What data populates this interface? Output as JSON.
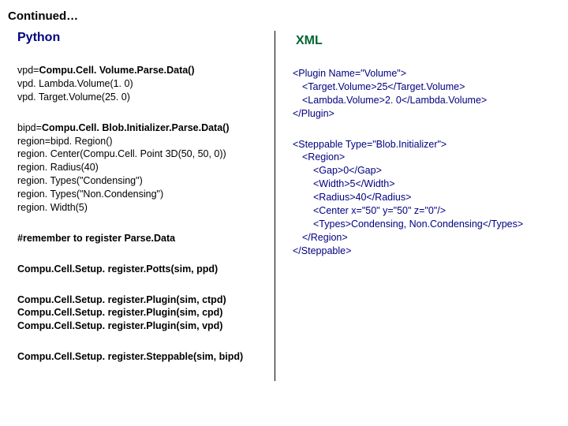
{
  "title": "Continued…",
  "left": {
    "heading": "Python",
    "block1": {
      "l1a": "vpd=",
      "l1b": "Compu.Cell. Volume.Parse.Data()",
      "l2": "vpd. Lambda.Volume(1. 0)",
      "l3": "vpd. Target.Volume(25. 0)"
    },
    "block2": {
      "l1a": "bipd=",
      "l1b": "Compu.Cell. Blob.Initializer.Parse.Data()",
      "l2": "region=bipd. Region()",
      "l3": "region. Center(Compu.Cell. Point 3D(50, 50, 0))",
      "l4": "region. Radius(40)",
      "l5": "region. Types(\"Condensing\")",
      "l6": "region. Types(\"Non.Condensing\")",
      "l7": "region. Width(5)"
    },
    "remember": "#remember to register Parse.Data",
    "reg1": "Compu.Cell.Setup. register.Potts(sim, ppd)",
    "reg2": "Compu.Cell.Setup. register.Plugin(sim, ctpd)",
    "reg3": "Compu.Cell.Setup. register.Plugin(sim, cpd)",
    "reg4": "Compu.Cell.Setup. register.Plugin(sim, vpd)",
    "reg5": "Compu.Cell.Setup. register.Steppable(sim, bipd)"
  },
  "right": {
    "heading": "XML",
    "x1": {
      "l1": "<Plugin Name=\"Volume\">",
      "l2": "<Target.Volume>25</Target.Volume>",
      "l3": "<Lambda.Volume>2. 0</Lambda.Volume>",
      "l4": "</Plugin>"
    },
    "x2": {
      "l1": "<Steppable Type=\"Blob.Initializer\">",
      "l2": "<Region>",
      "l3": "<Gap>0</Gap>",
      "l4": "<Width>5</Width>",
      "l5": "<Radius>40</Radius>",
      "l6": "<Center x=\"50\" y=\"50\" z=\"0\"/>",
      "l7": "<Types>Condensing, Non.Condensing</Types>",
      "l8": "</Region>",
      "l9": "</Steppable>"
    }
  }
}
